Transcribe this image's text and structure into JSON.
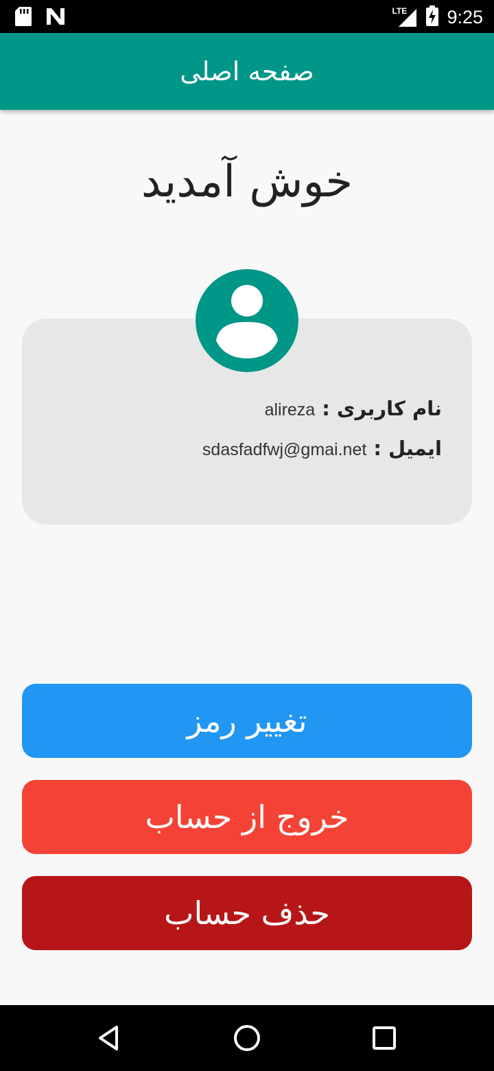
{
  "status_bar": {
    "time": "9:25",
    "network_label": "LTE",
    "icons": [
      "sd-card-icon",
      "n-notification-icon",
      "signal-icon",
      "battery-charging-icon"
    ]
  },
  "app_bar": {
    "title": "صفحه اصلی"
  },
  "welcome": {
    "text": "خوش آمدید"
  },
  "profile": {
    "avatar_icon": "account-circle-icon",
    "username_label": "نام کاربری :",
    "username_value": "alireza",
    "email_label": "ایمیل :",
    "email_value": "sdasfadfwj@gmai.net"
  },
  "buttons": {
    "change_password": "تغییر رمز",
    "logout": "خروج از حساب",
    "delete_account": "حذف حساب"
  },
  "nav_bar": {
    "icons": [
      "back-icon",
      "home-icon",
      "recents-icon"
    ]
  },
  "colors": {
    "primary": "#009688",
    "blue_button": "#2196f3",
    "red_button": "#f44336",
    "dark_red_button": "#b71618",
    "card_background": "#e8e7e8"
  }
}
